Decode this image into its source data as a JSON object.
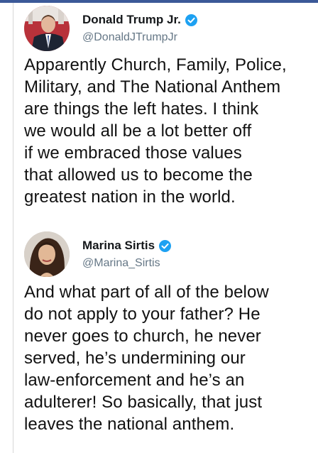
{
  "tweets": [
    {
      "author": {
        "name": "Donald Trump Jr.",
        "handle": "@DonaldJTrumpJr",
        "verified_icon": "verified-badge-icon"
      },
      "text": "Apparently Church, Family, Police,\nMilitary, and The National Anthem\nare things the left hates. I think\nwe would all be a lot better off\nif we embraced those values\nthat allowed us to become the\ngreatest nation in the world."
    },
    {
      "author": {
        "name": "Marina Sirtis",
        "handle": "@Marina_Sirtis",
        "verified_icon": "verified-badge-icon"
      },
      "text": "And what part of all of the below\ndo not apply to your father? He\nnever goes to church, he never\nserved, he’s undermining our\nlaw-enforcement and he’s an\nadulterer! So basically, that just\nleaves the national anthem."
    }
  ],
  "colors": {
    "verified": "#1da1f2",
    "handle": "#657786",
    "top_strip": "#3b5998"
  }
}
